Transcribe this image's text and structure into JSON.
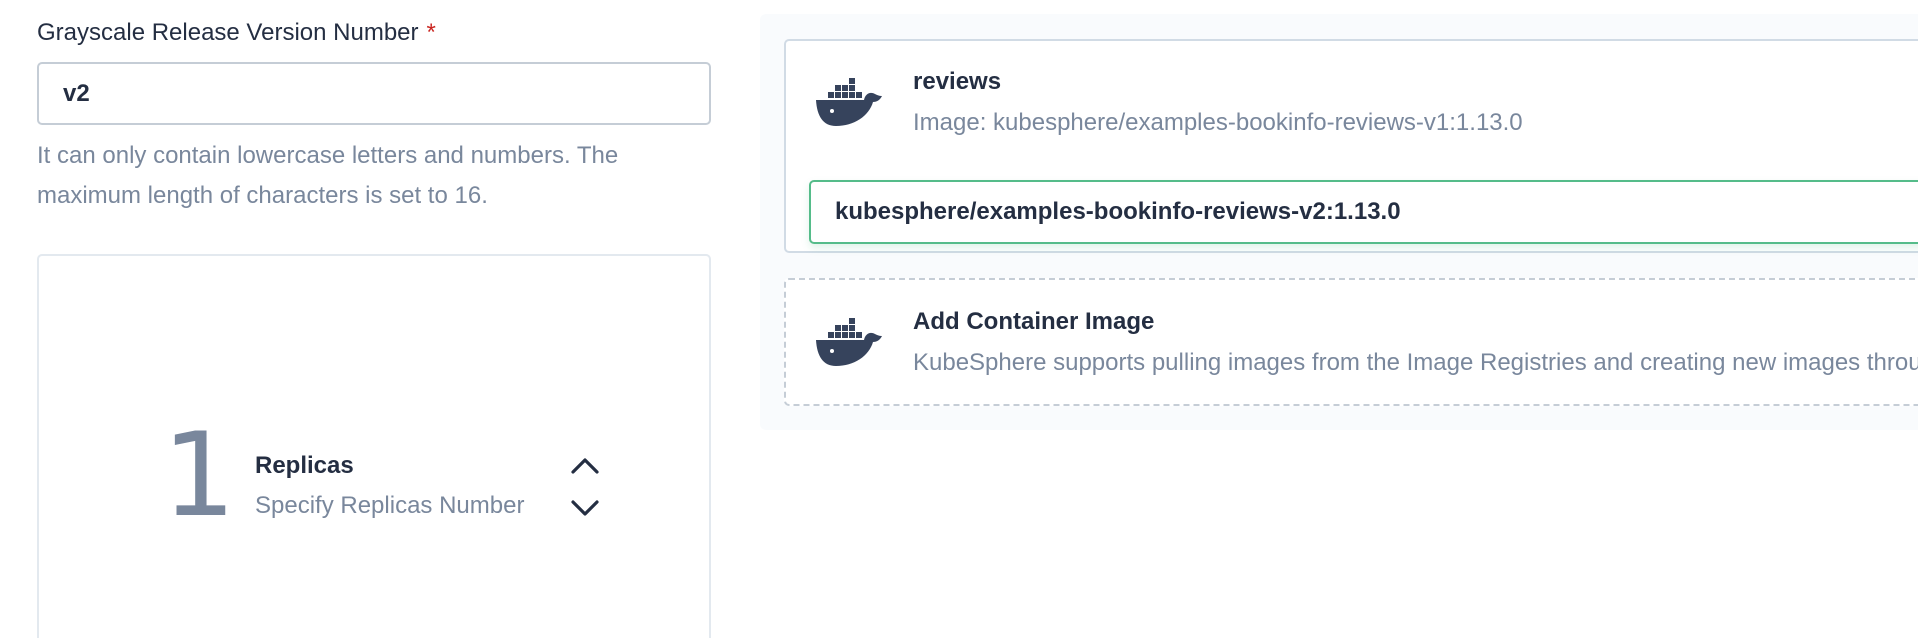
{
  "version_field": {
    "label": "Grayscale Release Version Number",
    "required_mark": "*",
    "value": "v2",
    "hint": "It can only contain lowercase letters and numbers. The maximum length of characters is set to 16."
  },
  "replicas": {
    "count": "1",
    "title": "Replicas",
    "description": "Specify Replicas Number"
  },
  "container": {
    "name": "reviews",
    "image_text": "Image: kubesphere/examples-bookinfo-reviews-v1:1.13.0",
    "new_image_value": "kubesphere/examples-bookinfo-reviews-v2:1.13.0",
    "icon": "docker-icon"
  },
  "add_container": {
    "title": "Add Container Image",
    "description": "KubeSphere supports pulling images from the Image Registries and creating new images throu",
    "icon": "docker-icon"
  },
  "colors": {
    "text_primary": "#242e42",
    "text_secondary": "#79879c",
    "required": "#ca2621",
    "focus_border": "#55bc8a"
  }
}
